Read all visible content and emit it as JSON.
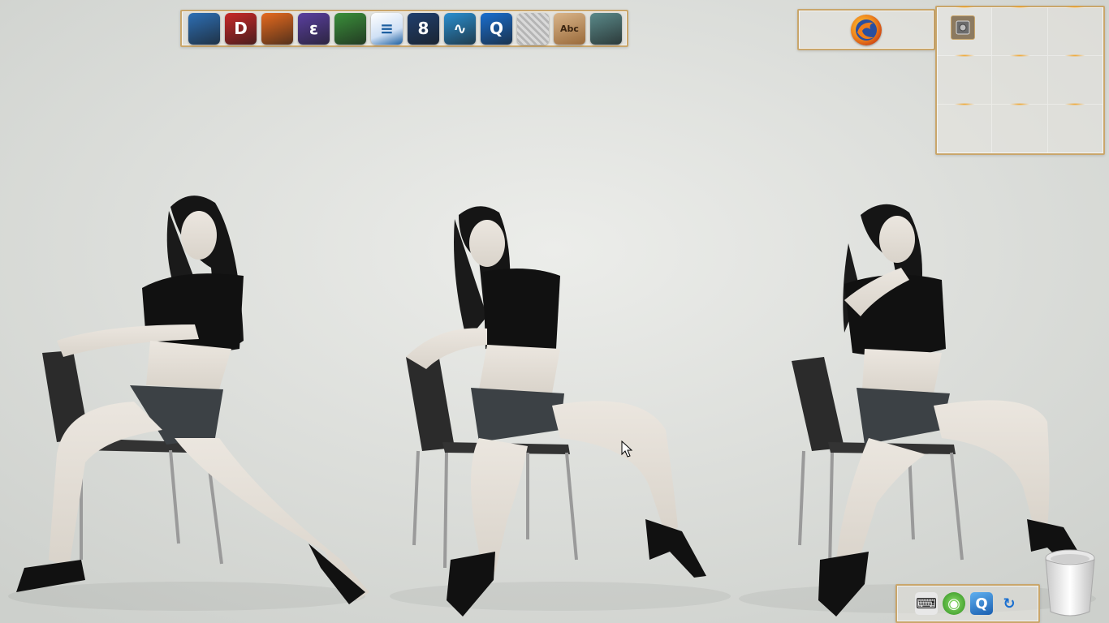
{
  "desktop": {
    "wallpaper": "wallpaper-photo",
    "accent_color": "#c9a66b"
  },
  "dock": {
    "launchers": [
      {
        "name": "scanner-icon",
        "color": "#2d6fb5",
        "glyph": ""
      },
      {
        "name": "document-viewer-icon",
        "color": "#c82828",
        "glyph": "D"
      },
      {
        "name": "firefox-icon",
        "color": "#e66a1e",
        "glyph": ""
      },
      {
        "name": "emacs-icon",
        "color": "#5a3fa0",
        "glyph": "ε"
      },
      {
        "name": "chrome-icon",
        "color": "#3a8f3a",
        "glyph": ""
      },
      {
        "name": "text-editor-icon",
        "color": "#1d5fa0",
        "glyph": "≡"
      },
      {
        "name": "infinity-app-icon",
        "color": "#1f3f6e",
        "glyph": "8"
      },
      {
        "name": "system-monitor-icon",
        "color": "#2a8fd0",
        "glyph": "∿"
      },
      {
        "name": "qq-icon",
        "color": "#1a6fd0",
        "glyph": "Q"
      },
      {
        "name": "mail-stamp-icon",
        "color": "#b8b8b8",
        "glyph": ""
      },
      {
        "name": "dictionary-icon",
        "color": "#b08050",
        "glyph": "Abc"
      },
      {
        "name": "bird-app-icon",
        "color": "#5a8a8a",
        "glyph": ""
      }
    ]
  },
  "taskbar": {
    "active_task_icon": "firefox-icon"
  },
  "pager": {
    "desktops": 9,
    "active_index": 0
  },
  "tray": {
    "icons": [
      "keyboard-icon",
      "network-icon",
      "qq-tray-icon",
      "swirl-icon"
    ]
  }
}
